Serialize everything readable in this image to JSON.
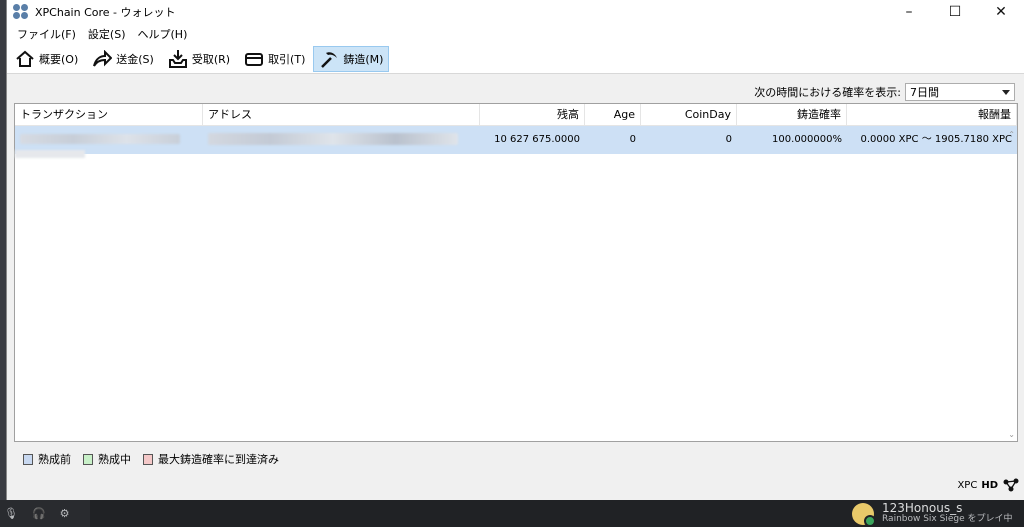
{
  "window": {
    "title": "XPChain Core - ウォレット"
  },
  "menu": [
    "ファイル(F)",
    "設定(S)",
    "ヘルプ(H)"
  ],
  "toolbar": {
    "overview": "概要(O)",
    "send": "送金(S)",
    "receive": "受取(R)",
    "transactions": "取引(T)",
    "mint": "鋳造(M)"
  },
  "filter": {
    "label": "次の時間における確率を表示:",
    "selected": "7日間"
  },
  "table": {
    "headers": [
      "トランザクション",
      "アドレス",
      "残高",
      "Age",
      "CoinDay",
      "鋳造確率",
      "報酬量"
    ],
    "rows": [
      {
        "balance": "10 627 675.0000",
        "age": "0",
        "coinday": "0",
        "probability": "100.000000%",
        "reward": "0.0000 XPC ～ 1905.7180 XPC"
      }
    ]
  },
  "legend": [
    {
      "label": "熟成前",
      "color": "#c8d8f0"
    },
    {
      "label": "熟成中",
      "color": "#c8f0c8"
    },
    {
      "label": "最大鋳造確率に到達済み",
      "color": "#f4c8c8"
    }
  ],
  "status": {
    "unit": "XPC",
    "hd": "HD"
  },
  "taskbar": {
    "user": "123Honous_s",
    "activity": "Rainbow Six Siege をプレイ中"
  }
}
